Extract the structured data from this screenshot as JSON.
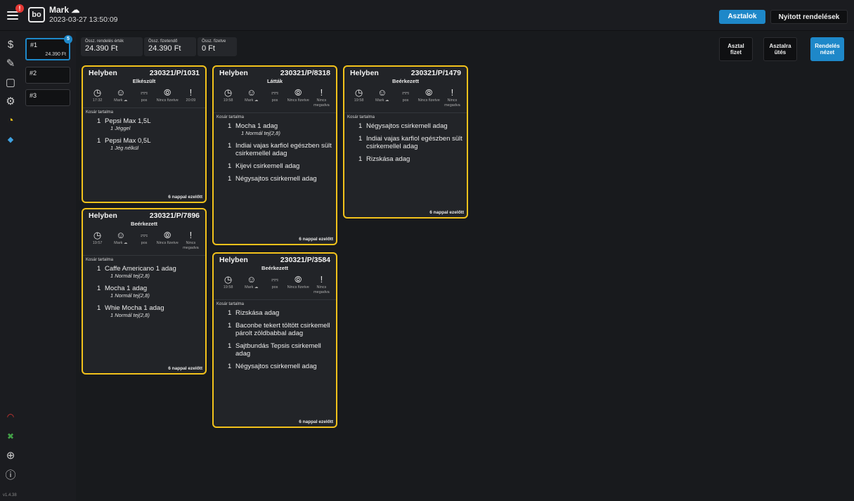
{
  "header": {
    "notification_badge": "!",
    "logo_text": "bo",
    "user": "Mark ☁",
    "datetime": "2023-03-27  13:50:09",
    "btn_tables": "Asztalok",
    "btn_open_orders": "Nyitott rendelések"
  },
  "sidebar": {
    "icons": [
      "dollar-icon",
      "edit-icon",
      "bag-icon",
      "gear-icon",
      "clock-alert-icon",
      "tag-icon",
      "wifi-signal-icon",
      "network-icon",
      "globe-icon",
      "info-icon"
    ],
    "glyphs": [
      "$",
      "✎",
      "▢",
      "⚙",
      "◔",
      "◆",
      "◠",
      "✖",
      "⊕",
      "ⓘ"
    ],
    "version": "v1.4.38"
  },
  "tables": [
    {
      "label": "#1",
      "amount": "24.390 Ft",
      "count": "5"
    },
    {
      "label": "#2",
      "amount": "",
      "count": ""
    },
    {
      "label": "#3",
      "amount": "",
      "count": ""
    }
  ],
  "summary": {
    "order_value_label": "Össz. rendelés érték",
    "order_value": "24.390 Ft",
    "payable_label": "Össz. fizetendő",
    "payable": "24.390 Ft",
    "paid_label": "Össz. fizetve",
    "paid": "0 Ft"
  },
  "actions": {
    "table_pay": "Asztal fizet",
    "table_fire": "Asztalra ütés",
    "order_view": "Rendelés nézet"
  },
  "icon_labels": {
    "pos": "pos",
    "unpaid": "Nincs fizetve",
    "not_given": "Nincs megadva"
  },
  "cart_title": "Kosár tartalma",
  "cards": [
    {
      "type": "Helyben",
      "id": "230321/P/1031",
      "status": "Elkészült",
      "time": "17:32",
      "user": "Mark ☁",
      "last": "20:09",
      "ago": "6 nappal ezelőtt",
      "items": [
        [
          "1",
          "Pepsi Max 1,5L",
          "1 Jéggel"
        ],
        [
          "1",
          "Pepsi Max 0,5L",
          "1 Jég nélkül"
        ]
      ]
    },
    {
      "type": "Helyben",
      "id": "230321/P/7896",
      "status": "Beérkezett",
      "time": "19:57",
      "user": "Mark ☁",
      "last": "Nincs megadva",
      "ago": "6 nappal ezelőtt",
      "items": [
        [
          "1",
          "Caffe Americano 1 adag",
          "1 Normál tej(2,8)"
        ],
        [
          "1",
          "Mocha 1 adag",
          "1 Normál tej(2,8)"
        ],
        [
          "1",
          "Whie Mocha 1 adag",
          "1 Normál tej(2,8)"
        ]
      ]
    },
    {
      "type": "Helyben",
      "id": "230321/P/8318",
      "status": "Látták",
      "time": "19:58",
      "user": "Mark ☁",
      "last": "Nincs megadva",
      "ago": "6 nappal ezelőtt",
      "items": [
        [
          "1",
          "Mocha 1 adag",
          "1 Normál tej(2,8)"
        ],
        [
          "1",
          "Indiai vajas karfiol egészben sült csirkemellel adag",
          ""
        ],
        [
          "1",
          "Kijevi csirkemell adag",
          ""
        ],
        [
          "1",
          "Négysajtos csirkemell adag",
          ""
        ]
      ]
    },
    {
      "type": "Helyben",
      "id": "230321/P/3584",
      "status": "Beérkezett",
      "time": "19:58",
      "user": "Mark ☁",
      "last": "Nincs megadva",
      "ago": "6 nappal ezelőtt",
      "items": [
        [
          "1",
          "Rizskása adag",
          ""
        ],
        [
          "1",
          "Baconbe tekert töltött csirkemell párolt zöldbabbal adag",
          ""
        ],
        [
          "1",
          "Sajtbundás Tepsis csirkemell adag",
          ""
        ],
        [
          "1",
          "Négysajtos csirkemell adag",
          ""
        ]
      ]
    },
    {
      "type": "Helyben",
      "id": "230321/P/1479",
      "status": "Beérkezett",
      "time": "19:58",
      "user": "Mark ☁",
      "last": "Nincs megadva",
      "ago": "6 nappal ezelőtt",
      "items": [
        [
          "1",
          "Négysajtos csirkemell adag",
          ""
        ],
        [
          "1",
          "Indiai vajas karfiol egészben sült csirkemellel adag",
          ""
        ],
        [
          "1",
          "Rizskása adag",
          ""
        ]
      ]
    }
  ]
}
